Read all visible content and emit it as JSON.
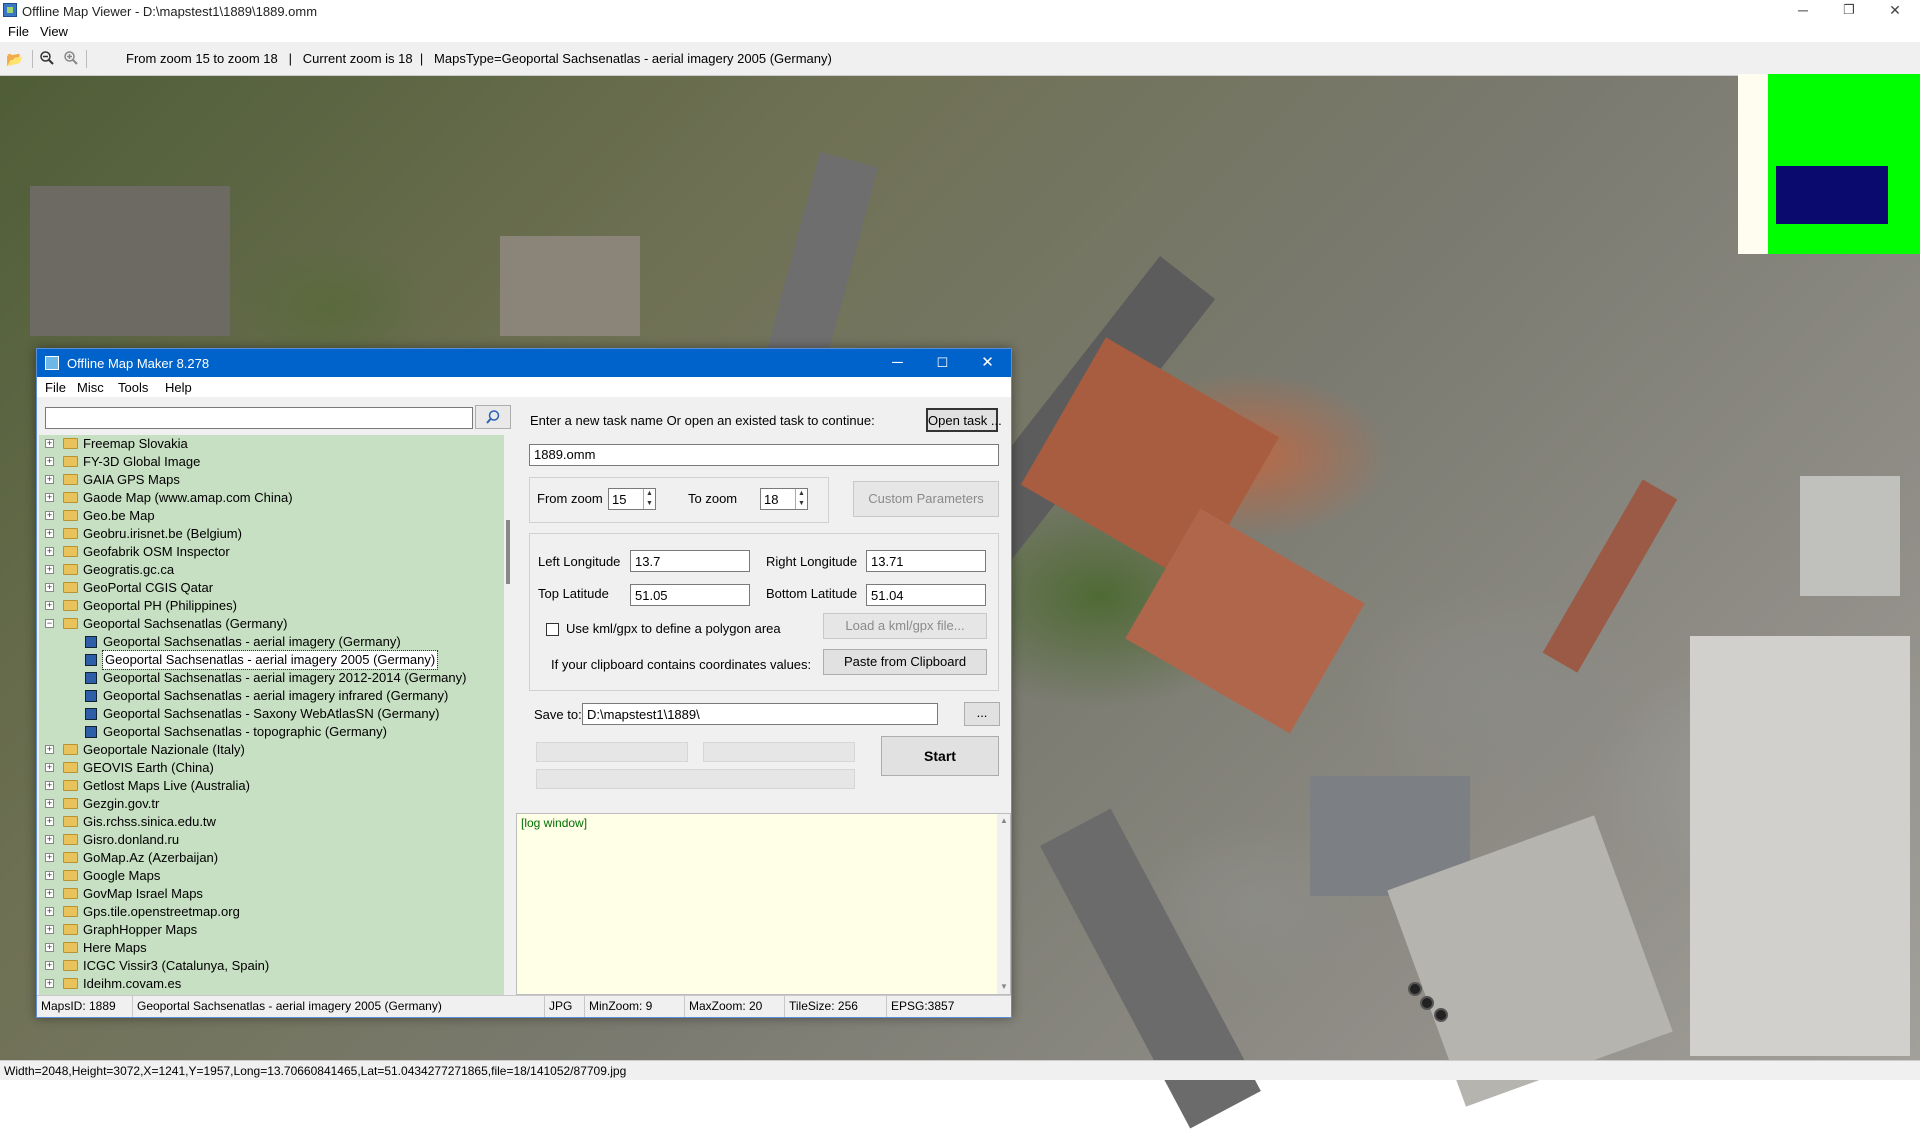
{
  "window": {
    "title": "Offline Map Viewer - D:\\mapstest1\\1889\\1889.omm",
    "minimize": "─",
    "maximize": "❐",
    "close": "✕"
  },
  "menubar": {
    "items": [
      "File",
      "View"
    ]
  },
  "toolbar": {
    "status": "From zoom 15 to zoom 18   |   Current zoom is 18  |   MapsType=Geoportal Sachsenatlas - aerial imagery 2005 (Germany)"
  },
  "statusbar": {
    "text": "Width=2048,Height=3072,X=1241,Y=1957,Long=13.70660841465,Lat=51.0434277271865,file=18/141052/87709.jpg"
  },
  "dialog": {
    "title": "Offline Map Maker 8.278",
    "menu": [
      "File",
      "Misc",
      "Tools",
      "Help"
    ],
    "search": {
      "value": "",
      "button_icon": "search-icon"
    },
    "tree": [
      {
        "label": "Freemap Slovakia",
        "level": 0,
        "type": "folder"
      },
      {
        "label": "FY-3D Global Image",
        "level": 0,
        "type": "folder"
      },
      {
        "label": "GAIA GPS Maps",
        "level": 0,
        "type": "folder"
      },
      {
        "label": "Gaode Map (www.amap.com China)",
        "level": 0,
        "type": "folder"
      },
      {
        "label": "Geo.be Map",
        "level": 0,
        "type": "folder"
      },
      {
        "label": "Geobru.irisnet.be (Belgium)",
        "level": 0,
        "type": "folder"
      },
      {
        "label": "Geofabrik OSM Inspector",
        "level": 0,
        "type": "folder"
      },
      {
        "label": "Geogratis.gc.ca",
        "level": 0,
        "type": "folder"
      },
      {
        "label": "GeoPortal CGIS Qatar",
        "level": 0,
        "type": "folder"
      },
      {
        "label": "Geoportal PH (Philippines)",
        "level": 0,
        "type": "folder"
      },
      {
        "label": "Geoportal Sachsenatlas (Germany)",
        "level": 0,
        "type": "folder-open"
      },
      {
        "label": "Geoportal Sachsenatlas - aerial imagery (Germany)",
        "level": 1,
        "type": "map"
      },
      {
        "label": "Geoportal Sachsenatlas - aerial imagery 2005 (Germany)",
        "level": 1,
        "type": "map",
        "selected": true
      },
      {
        "label": "Geoportal Sachsenatlas - aerial imagery 2012-2014 (Germany)",
        "level": 1,
        "type": "map"
      },
      {
        "label": "Geoportal Sachsenatlas - aerial imagery infrared (Germany)",
        "level": 1,
        "type": "map"
      },
      {
        "label": "Geoportal Sachsenatlas - Saxony WebAtlasSN (Germany)",
        "level": 1,
        "type": "map"
      },
      {
        "label": "Geoportal Sachsenatlas - topographic (Germany)",
        "level": 1,
        "type": "map"
      },
      {
        "label": "Geoportale Nazionale (Italy)",
        "level": 0,
        "type": "folder"
      },
      {
        "label": "GEOVIS Earth (China)",
        "level": 0,
        "type": "folder"
      },
      {
        "label": "Getlost Maps Live (Australia)",
        "level": 0,
        "type": "folder"
      },
      {
        "label": "Gezgin.gov.tr",
        "level": 0,
        "type": "folder"
      },
      {
        "label": "Gis.rchss.sinica.edu.tw",
        "level": 0,
        "type": "folder"
      },
      {
        "label": "Gisro.donland.ru",
        "level": 0,
        "type": "folder"
      },
      {
        "label": "GoMap.Az (Azerbaijan)",
        "level": 0,
        "type": "folder"
      },
      {
        "label": "Google Maps",
        "level": 0,
        "type": "folder"
      },
      {
        "label": "GovMap Israel Maps",
        "level": 0,
        "type": "folder"
      },
      {
        "label": "Gps.tile.openstreetmap.org",
        "level": 0,
        "type": "folder"
      },
      {
        "label": "GraphHopper Maps",
        "level": 0,
        "type": "folder"
      },
      {
        "label": "Here Maps",
        "level": 0,
        "type": "folder"
      },
      {
        "label": "ICGC Vissir3 (Catalunya, Spain)",
        "level": 0,
        "type": "folder"
      },
      {
        "label": "Ideihm.covam.es",
        "level": 0,
        "type": "folder"
      }
    ],
    "task_prompt": "Enter a new task name Or open an existed task to continue:",
    "open_task": "Open task ...",
    "task_name": "1889.omm",
    "from_zoom_label": "From zoom",
    "from_zoom": "15",
    "to_zoom_label": "To zoom",
    "to_zoom": "18",
    "custom_params": "Custom Parameters",
    "left_lon_label": "Left Longitude",
    "left_lon": "13.7",
    "right_lon_label": "Right Longitude",
    "right_lon": "13.71",
    "top_lat_label": "Top Latitude",
    "top_lat": "51.05",
    "bottom_lat_label": "Bottom Latitude",
    "bottom_lat": "51.04",
    "kml_label": "Use kml/gpx to define a polygon area",
    "kml_button": "Load a kml/gpx file...",
    "clipboard_label": "If your clipboard contains coordinates values:",
    "clipboard_button": "Paste from Clipboard",
    "save_label": "Save to:",
    "save_path": "D:\\mapstest1\\1889\\",
    "browse": "...",
    "start": "Start",
    "log": "[log window]",
    "status": {
      "maps_id": "MapsID: 1889",
      "maps_name": "Geoportal Sachsenatlas - aerial imagery 2005 (Germany)",
      "format": "JPG",
      "min_zoom": "MinZoom: 9",
      "max_zoom": "MaxZoom: 20",
      "tile_size": "TileSize: 256",
      "epsg": "EPSG:3857"
    }
  }
}
